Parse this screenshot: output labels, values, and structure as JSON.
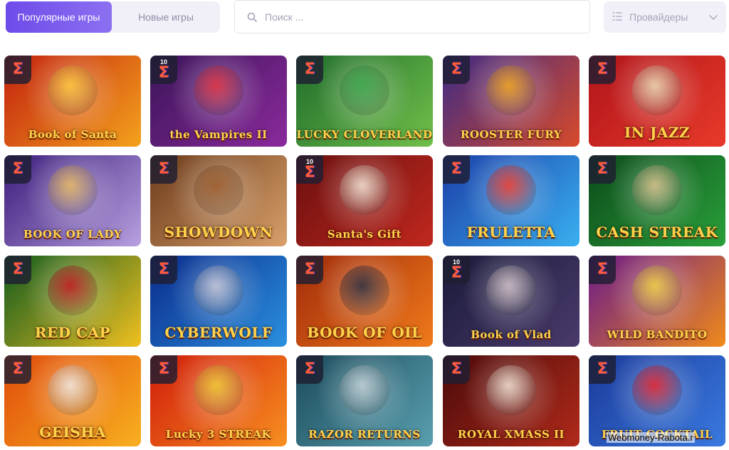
{
  "tabs": [
    {
      "label": "Популярные игры",
      "active": true
    },
    {
      "label": "Новые игры",
      "active": false
    }
  ],
  "search": {
    "placeholder": "Поиск ...",
    "value": ""
  },
  "providers": {
    "label": "Провайдеры",
    "icon": "filter-icon"
  },
  "games": [
    {
      "title": "Book of Santa",
      "badge": "",
      "bg": [
        "#c2200f",
        "#f4a21c"
      ],
      "accent": "#ffc83a"
    },
    {
      "title": "the Vampires II",
      "badge": "10",
      "bg": [
        "#3a1458",
        "#8b2a9c"
      ],
      "accent": "#e23040"
    },
    {
      "title": "LUCKY CLOVERLAND",
      "badge": "",
      "bg": [
        "#1f6b2b",
        "#71c04a"
      ],
      "accent": "#3aa64a"
    },
    {
      "title": "ROOSTER FURY",
      "badge": "",
      "bg": [
        "#3c2a86",
        "#d84a2a"
      ],
      "accent": "#f0a21a"
    },
    {
      "title": "IN JAZZ",
      "badge": "",
      "bg": [
        "#b0141a",
        "#e83a2a"
      ],
      "accent": "#e9d7b0"
    },
    {
      "title": "BOOK OF LADY",
      "badge": "",
      "bg": [
        "#3a1a7a",
        "#b8a0e0"
      ],
      "accent": "#e8b860"
    },
    {
      "title": "SHOWDOWN",
      "badge": "",
      "bg": [
        "#6b3a1a",
        "#d9a06a"
      ],
      "accent": "#9b5a2a"
    },
    {
      "title": "Santa's Gift",
      "badge": "10",
      "bg": [
        "#6a0f0f",
        "#c0281e"
      ],
      "accent": "#f2e2d0"
    },
    {
      "title": "FRULETTA",
      "badge": "",
      "bg": [
        "#1a3ea8",
        "#3ab0f0"
      ],
      "accent": "#f23a2a"
    },
    {
      "title": "CASH STREAK",
      "badge": "",
      "bg": [
        "#0c4a1a",
        "#2aa03a"
      ],
      "accent": "#d8c08a"
    },
    {
      "title": "RED CAP",
      "badge": "",
      "bg": [
        "#0e5a1e",
        "#f0c020"
      ],
      "accent": "#c0141a"
    },
    {
      "title": "CYBERWOLF",
      "badge": "",
      "bg": [
        "#0a2a8a",
        "#2a90e0"
      ],
      "accent": "#c8c8d8"
    },
    {
      "title": "BOOK OF OIL",
      "badge": "",
      "bg": [
        "#a02a0a",
        "#f07a1a"
      ],
      "accent": "#2a2a3a"
    },
    {
      "title": "Book of Vlad",
      "badge": "10",
      "bg": [
        "#1a1a3a",
        "#4a3a6a"
      ],
      "accent": "#d0c0c8"
    },
    {
      "title": "WILD BANDITO",
      "badge": "",
      "bg": [
        "#6a1a8a",
        "#f08a1a"
      ],
      "accent": "#f0d040"
    },
    {
      "title": "GEISHA",
      "badge": "",
      "bg": [
        "#e04a0a",
        "#f8b020"
      ],
      "accent": "#f0e8e0"
    },
    {
      "title": "Lucky 3 STREAK",
      "badge": "",
      "bg": [
        "#d01a0a",
        "#f89020"
      ],
      "accent": "#f0c830"
    },
    {
      "title": "RAZOR RETURNS",
      "badge": "",
      "bg": [
        "#1a4a5a",
        "#5aa0b0"
      ],
      "accent": "#c0d0d8"
    },
    {
      "title": "ROYAL XMASS II",
      "badge": "",
      "bg": [
        "#4a0a0a",
        "#b02a1a"
      ],
      "accent": "#f0e0d0"
    },
    {
      "title": "FRUIT COCKTAIL",
      "badge": "",
      "bg": [
        "#1a3a9a",
        "#3a7ae0"
      ],
      "accent": "#e8202a"
    }
  ],
  "watermark": "Webmoney-Rabota.r"
}
